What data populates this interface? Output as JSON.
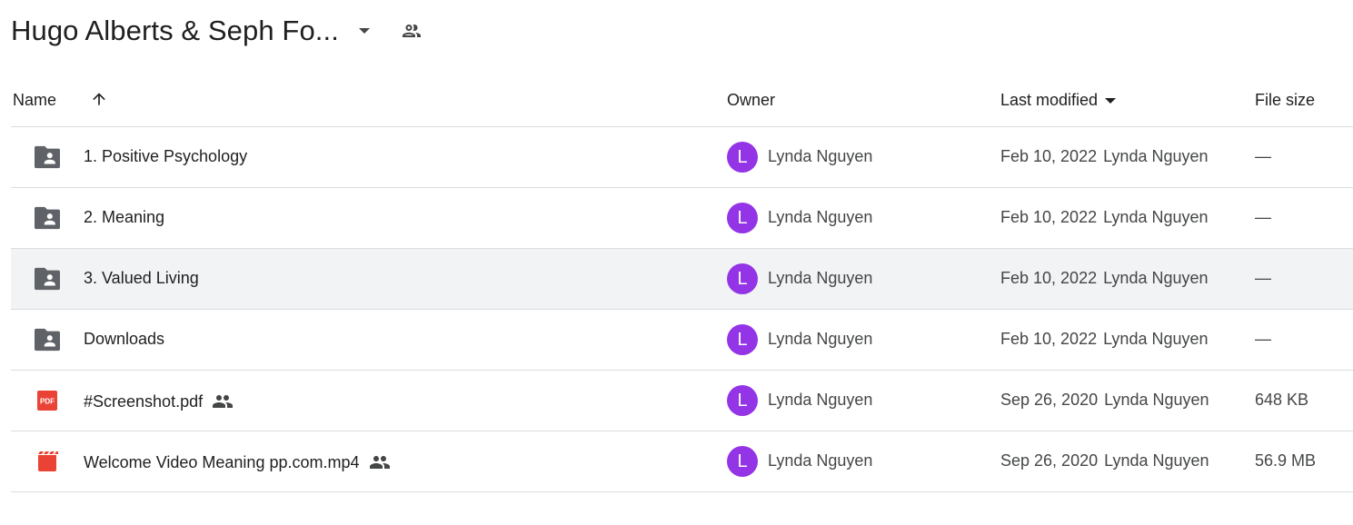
{
  "header": {
    "folder_title": "Hugo Alberts & Seph Fo...",
    "dropdown_icon": "caret-down-icon",
    "shared_icon": "people-outline-icon"
  },
  "columns": {
    "name": "Name",
    "owner": "Owner",
    "last_modified": "Last modified",
    "file_size": "File size",
    "sort_icon": "arrow-up-icon"
  },
  "colors": {
    "avatar_bg": "#9334e6",
    "folder_icon": "#5f6368",
    "pdf_icon": "#ea4335",
    "video_icon": "#ea4335",
    "row_hover": "#f1f3f4"
  },
  "rows": [
    {
      "type": "shared-folder-icon",
      "name": "1. Positive Psychology",
      "shared": false,
      "avatar": "L",
      "owner": "Lynda Nguyen",
      "modified_date": "Feb 10, 2022",
      "modified_by": "Lynda Nguyen",
      "size": "—"
    },
    {
      "type": "shared-folder-icon",
      "name": "2. Meaning",
      "shared": false,
      "avatar": "L",
      "owner": "Lynda Nguyen",
      "modified_date": "Feb 10, 2022",
      "modified_by": "Lynda Nguyen",
      "size": "—"
    },
    {
      "type": "shared-folder-icon",
      "name": "3. Valued Living",
      "shared": false,
      "avatar": "L",
      "owner": "Lynda Nguyen",
      "modified_date": "Feb 10, 2022",
      "modified_by": "Lynda Nguyen",
      "size": "—"
    },
    {
      "type": "shared-folder-icon",
      "name": "Downloads",
      "shared": false,
      "avatar": "L",
      "owner": "Lynda Nguyen",
      "modified_date": "Feb 10, 2022",
      "modified_by": "Lynda Nguyen",
      "size": "—"
    },
    {
      "type": "pdf-icon",
      "pdf_label": "PDF",
      "name": "#Screenshot.pdf",
      "shared": true,
      "avatar": "L",
      "owner": "Lynda Nguyen",
      "modified_date": "Sep 26, 2020",
      "modified_by": "Lynda Nguyen",
      "size": "648 KB"
    },
    {
      "type": "video-icon",
      "name": "Welcome Video Meaning pp.com.mp4",
      "shared": true,
      "avatar": "L",
      "owner": "Lynda Nguyen",
      "modified_date": "Sep 26, 2020",
      "modified_by": "Lynda Nguyen",
      "size": "56.9 MB"
    }
  ]
}
